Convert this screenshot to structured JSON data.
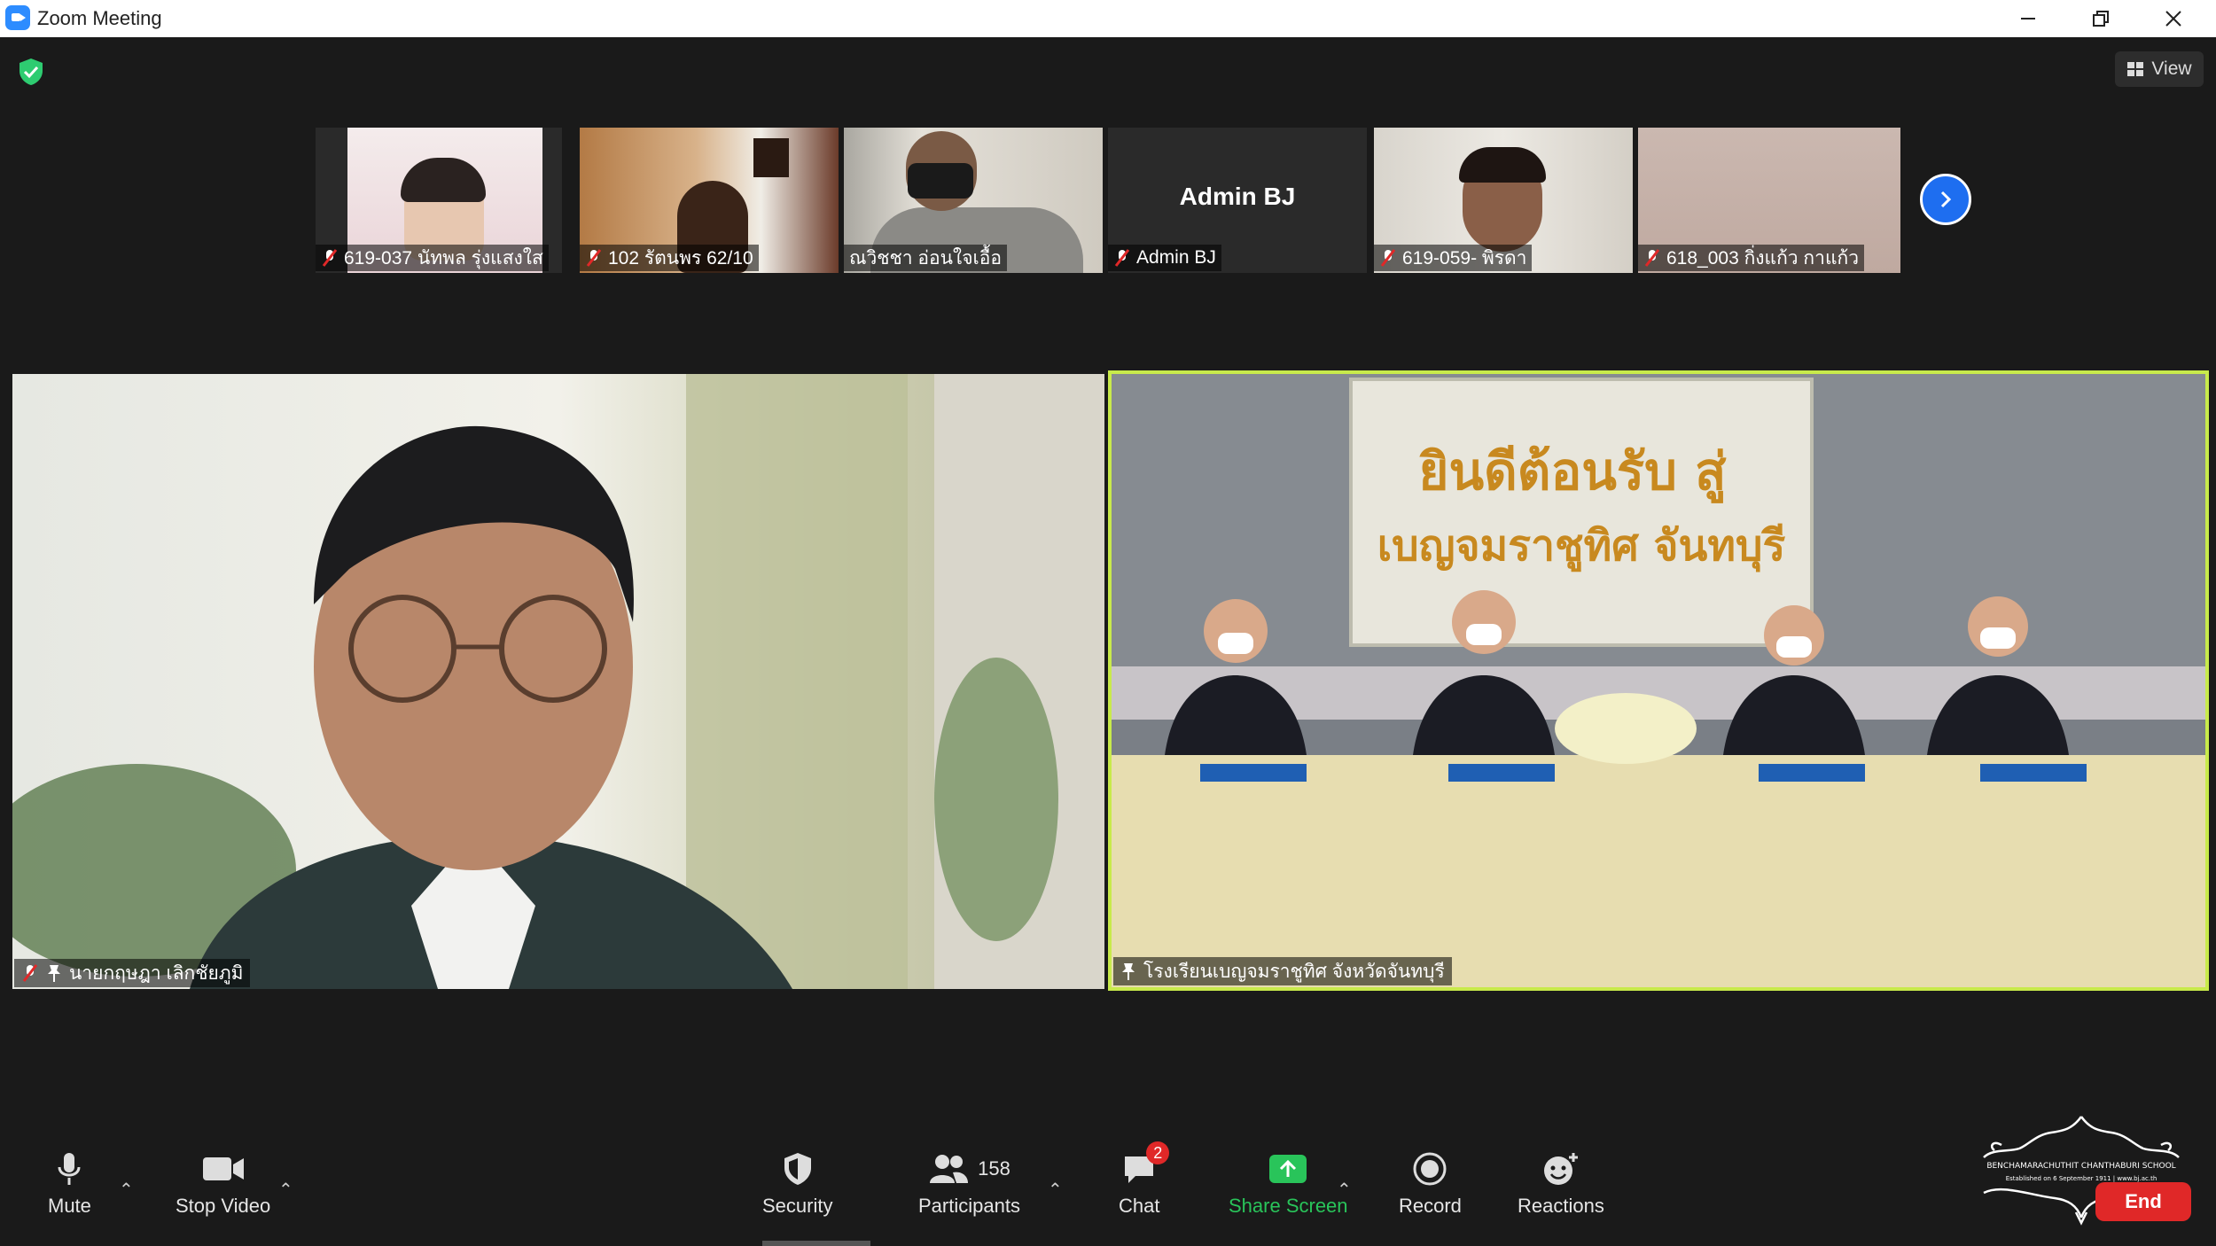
{
  "window": {
    "title": "Zoom Meeting",
    "controls": [
      "minimize",
      "restore",
      "close"
    ]
  },
  "header": {
    "view_label": "View"
  },
  "gallery": [
    {
      "name": "619-037 นัทพล รุ่งแสงใส",
      "muted": true
    },
    {
      "name": "102 รัตนพร 62/10",
      "muted": true
    },
    {
      "name": "ณวิชชา อ่อนใจเอื้อ",
      "muted": false
    },
    {
      "name": "Admin BJ",
      "muted": true,
      "display_name": "Admin BJ"
    },
    {
      "name": "619-059- พิรดา",
      "muted": true
    },
    {
      "name": "618_003 กิ่งแก้ว กาแก้ว",
      "muted": true
    }
  ],
  "main": {
    "left_tile": {
      "name": "นายกฤษฎา เลิกชัยภูมิ",
      "muted": true,
      "pinned": true
    },
    "right_tile": {
      "name": "โรงเรียนเบญจมราชูทิศ จังหวัดจันทบุรี",
      "pinned": true,
      "active_speaker": true,
      "banner_text_line1": "ยินดีต้อนรับ สู่",
      "banner_text_line2": "เบญจมราชูทิศ จันทบุรี"
    }
  },
  "toolbar": {
    "mute_label": "Mute",
    "stop_video_label": "Stop Video",
    "security_label": "Security",
    "participants_label": "Participants",
    "participants_count": "158",
    "chat_label": "Chat",
    "chat_badge": "2",
    "share_label": "Share Screen",
    "record_label": "Record",
    "reactions_label": "Reactions",
    "end_label": "End"
  },
  "watermark": {
    "line1": "BENCHAMARACHUTHIT CHANTHABURI SCHOOL",
    "line2": "Established on 6 September 1911 | www.bj.ac.th"
  },
  "colors": {
    "accent": "#2d8cff",
    "active_border": "#c8ea4b",
    "share_green": "#29c45a",
    "end_red": "#e02828",
    "muted_red": "#e02828"
  }
}
